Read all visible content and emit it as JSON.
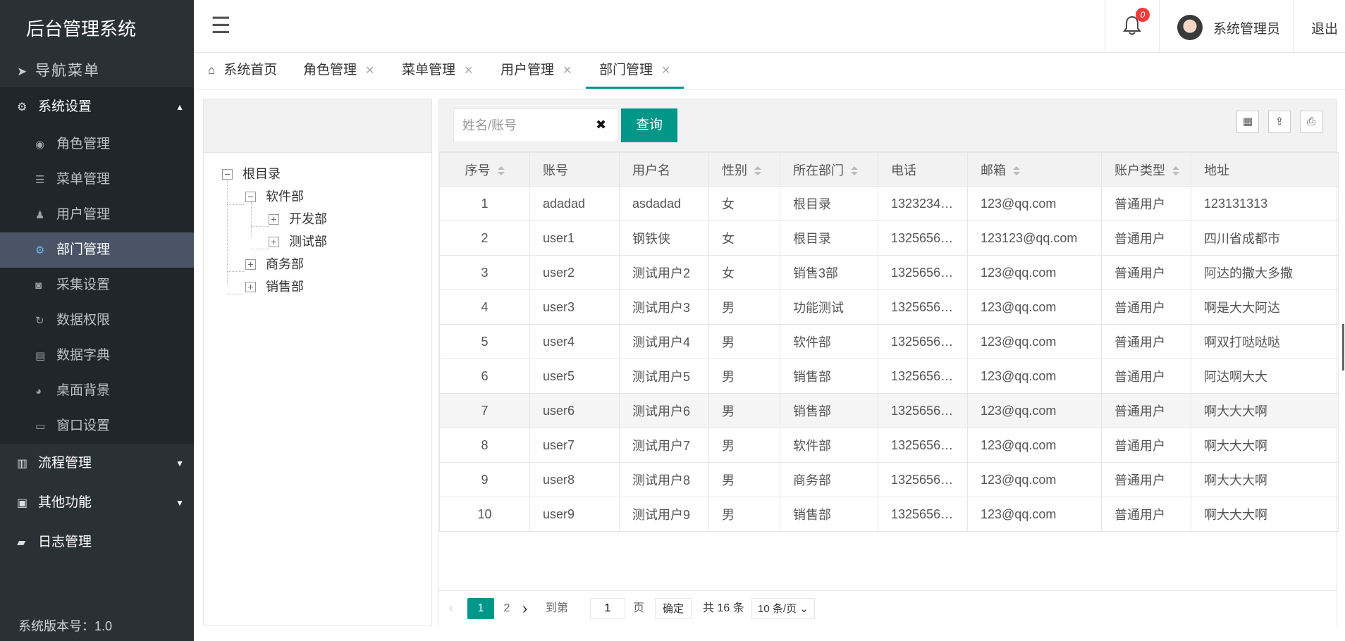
{
  "app": {
    "title": "后台管理系统",
    "version": "系统版本号：1.0"
  },
  "sidebar": {
    "nav_title": "导航菜单",
    "groups": [
      {
        "label": "系统设置",
        "icon": "gear-icon",
        "open": true
      },
      {
        "label": "流程管理",
        "icon": "barcode-icon"
      },
      {
        "label": "其他功能",
        "icon": "briefcase-icon"
      },
      {
        "label": "日志管理",
        "icon": "book-icon"
      }
    ],
    "items": [
      {
        "label": "角色管理",
        "icon": "circle-dot-icon"
      },
      {
        "label": "菜单管理",
        "icon": "list-icon"
      },
      {
        "label": "用户管理",
        "icon": "user-icon"
      },
      {
        "label": "部门管理",
        "icon": "cogs-icon",
        "active": true
      },
      {
        "label": "采集设置",
        "icon": "camera-icon"
      },
      {
        "label": "数据权限",
        "icon": "refresh-icon"
      },
      {
        "label": "数据字典",
        "icon": "card-icon"
      },
      {
        "label": "桌面背景",
        "icon": "palette-icon"
      },
      {
        "label": "窗口设置",
        "icon": "window-icon"
      }
    ]
  },
  "header": {
    "notification_count": "0",
    "username": "系统管理员",
    "logout": "退出"
  },
  "tabs": [
    {
      "label": "系统首页",
      "closable": false
    },
    {
      "label": "角色管理",
      "closable": true
    },
    {
      "label": "菜单管理",
      "closable": true
    },
    {
      "label": "用户管理",
      "closable": true
    },
    {
      "label": "部门管理",
      "closable": true,
      "active": true
    }
  ],
  "tree": {
    "root": "根目录",
    "nodes": [
      "软件部",
      "开发部",
      "测试部",
      "商务部",
      "销售部"
    ]
  },
  "search": {
    "placeholder": "姓名/账号",
    "button": "查询"
  },
  "table": {
    "columns": [
      "序号",
      "账号",
      "用户名",
      "性别",
      "所在部门",
      "电话",
      "邮箱",
      "账户类型",
      "地址"
    ],
    "rows": [
      [
        "1",
        "adadad",
        "asdadad",
        "女",
        "根目录",
        "1323234…",
        "123@qq.com",
        "普通用户",
        "123131313"
      ],
      [
        "2",
        "user1",
        "钢铁侠",
        "女",
        "根目录",
        "1325656…",
        "123123@qq.com",
        "普通用户",
        "四川省成都市"
      ],
      [
        "3",
        "user2",
        "测试用户2",
        "女",
        "销售3部",
        "1325656…",
        "123@qq.com",
        "普通用户",
        "阿达的撒大多撒"
      ],
      [
        "4",
        "user3",
        "测试用户3",
        "男",
        "功能测试",
        "1325656…",
        "123@qq.com",
        "普通用户",
        "啊是大大阿达"
      ],
      [
        "5",
        "user4",
        "测试用户4",
        "男",
        "软件部",
        "1325656…",
        "123@qq.com",
        "普通用户",
        "啊双打哒哒哒"
      ],
      [
        "6",
        "user5",
        "测试用户5",
        "男",
        "销售部",
        "1325656…",
        "123@qq.com",
        "普通用户",
        "阿达啊大大"
      ],
      [
        "7",
        "user6",
        "测试用户6",
        "男",
        "销售部",
        "1325656…",
        "123@qq.com",
        "普通用户",
        "啊大大大啊"
      ],
      [
        "8",
        "user7",
        "测试用户7",
        "男",
        "软件部",
        "1325656…",
        "123@qq.com",
        "普通用户",
        "啊大大大啊"
      ],
      [
        "9",
        "user8",
        "测试用户8",
        "男",
        "商务部",
        "1325656…",
        "123@qq.com",
        "普通用户",
        "啊大大大啊"
      ],
      [
        "10",
        "user9",
        "测试用户9",
        "男",
        "销售部",
        "1325656…",
        "123@qq.com",
        "普通用户",
        "啊大大大啊"
      ]
    ]
  },
  "pager": {
    "pages": [
      "1",
      "2"
    ],
    "goto_label": "到第",
    "goto_value": "1",
    "page_unit": "页",
    "confirm": "确定",
    "total": "共 16 条",
    "per_page": "10 条/页"
  }
}
